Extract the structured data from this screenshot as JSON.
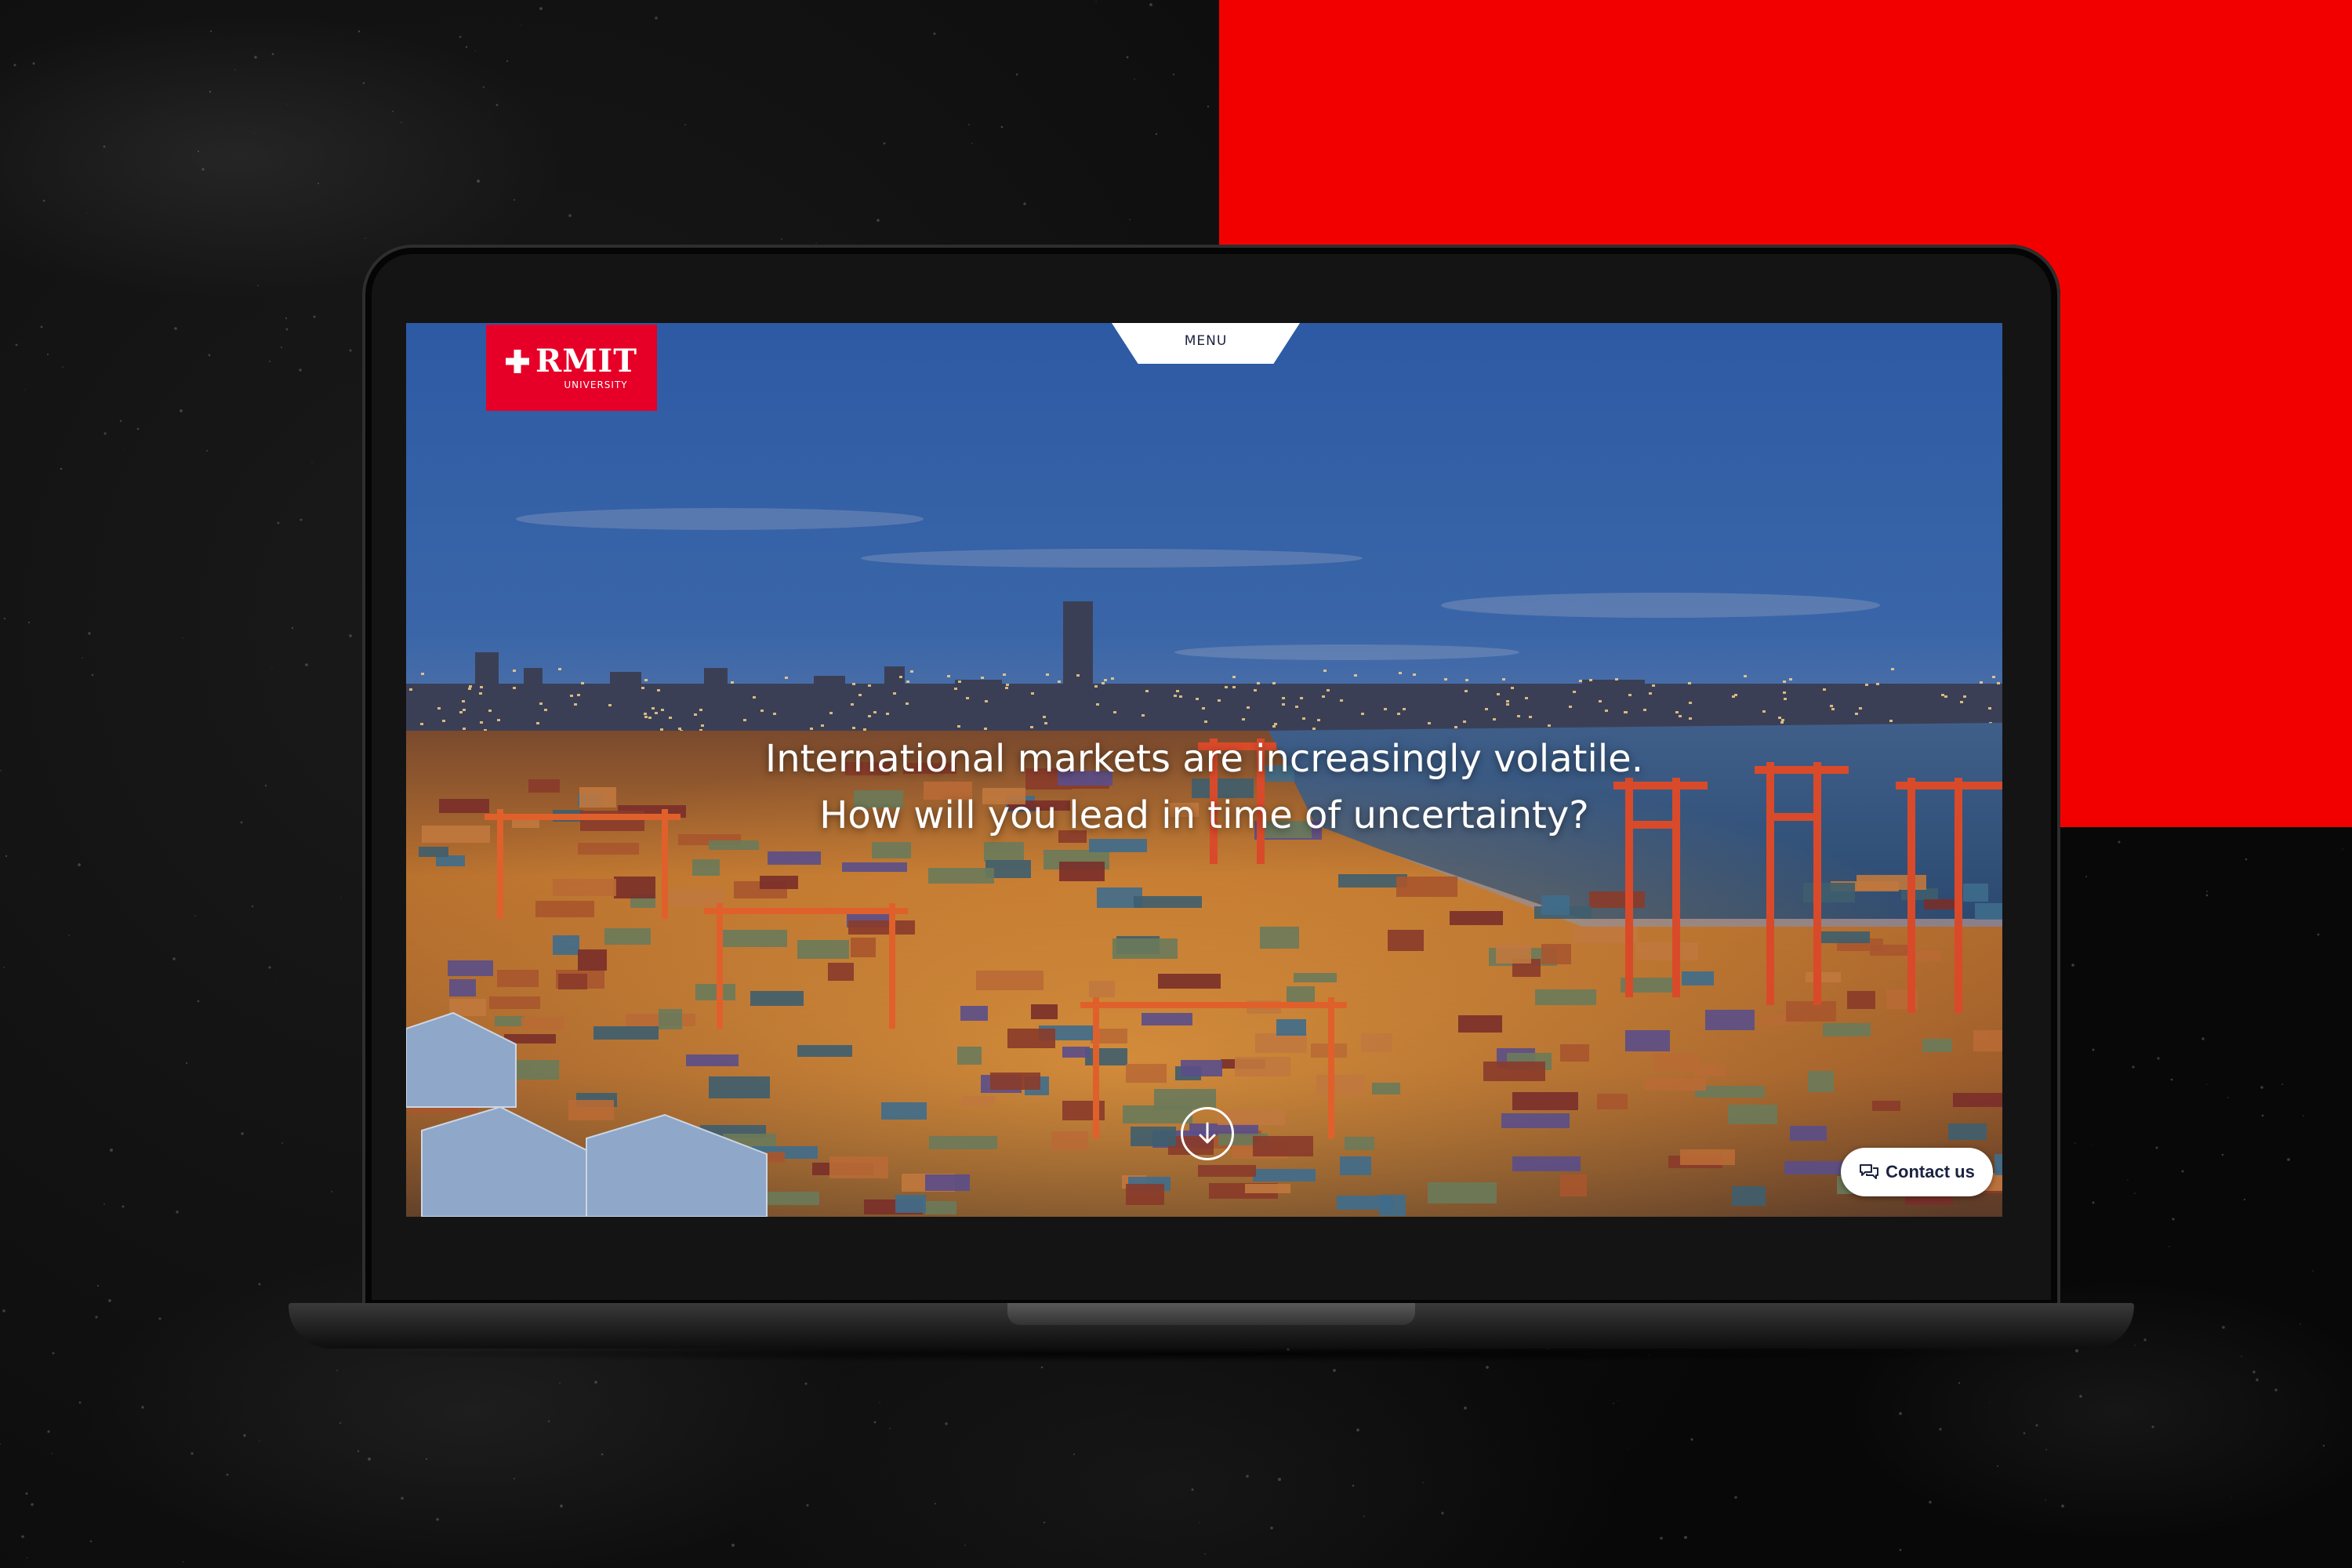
{
  "logo": {
    "name": "RMIT",
    "subtitle": "UNIVERSITY"
  },
  "nav": {
    "menu_label": "MENU"
  },
  "hero": {
    "headline_line1": "International markets are increasingly volatile.",
    "headline_line2": "How will you lead in time of uncertainty?",
    "scroll_icon": "arrow-down-icon"
  },
  "contact": {
    "label": "Contact us",
    "icon": "chat-icon"
  },
  "colors": {
    "brand_red": "#e60028",
    "backdrop_red": "#f20000",
    "navy_text": "#1b2340"
  }
}
